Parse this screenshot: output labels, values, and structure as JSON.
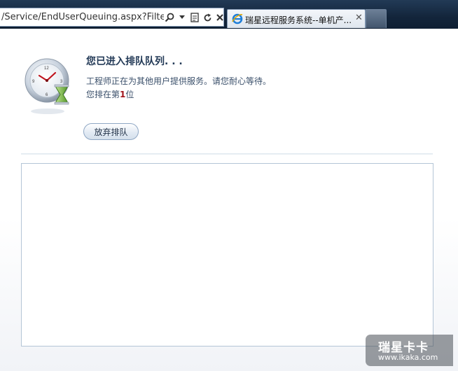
{
  "browser": {
    "address_text": "/Service/EndUserQueuing.aspx?FilterGr",
    "tab_title": "瑞星远程服务系统--单机产...",
    "tab_close_glyph": "✕",
    "icons": [
      "search-icon",
      "dropdown-icon",
      "compatibility-icon",
      "refresh-icon",
      "stop-icon",
      "ie-icon",
      "tab-close-icon"
    ]
  },
  "queue": {
    "title": "您已进入排队队列. . .",
    "message": "工程师正在为其他用户提供服务。请您耐心等待。",
    "position_prefix": "您排在第",
    "position_value": "1",
    "position_suffix": "位",
    "abandon_button": "放弃排队"
  },
  "watermark": {
    "brand": "瑞星卡卡",
    "url": "www.ikaka.com"
  },
  "colors": {
    "title": "#233a57",
    "text": "#3a4f6a",
    "position_number": "#a0131b",
    "chrome_bg": "#13253b"
  }
}
